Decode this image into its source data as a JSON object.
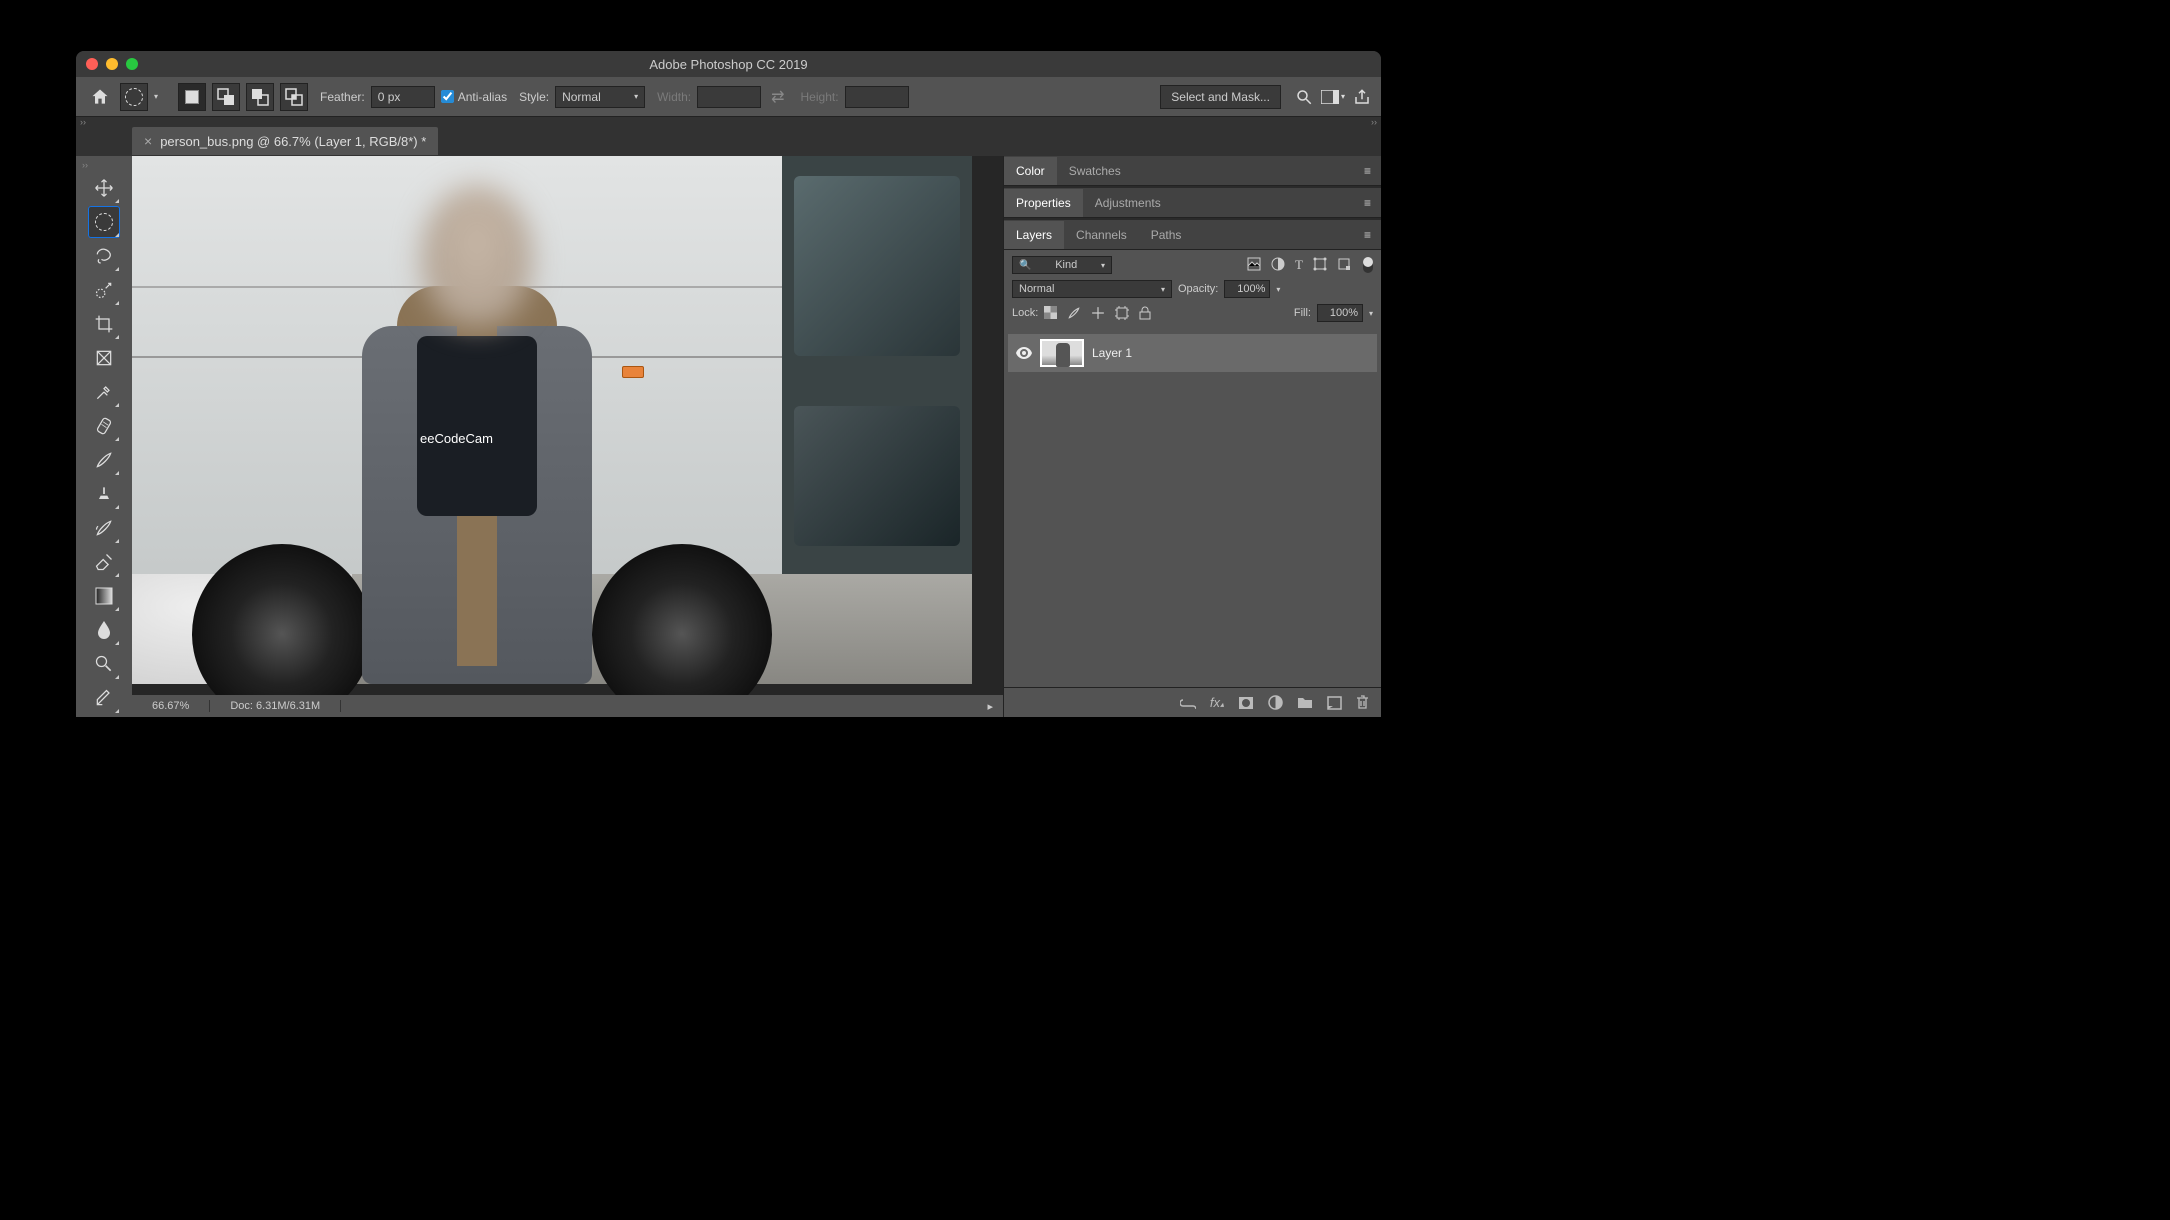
{
  "titlebar": {
    "title": "Adobe Photoshop CC 2019"
  },
  "options": {
    "feather_label": "Feather:",
    "feather_value": "0 px",
    "antialias_label": "Anti-alias",
    "antialias_checked": true,
    "style_label": "Style:",
    "style_value": "Normal",
    "width_label": "Width:",
    "width_value": "",
    "height_label": "Height:",
    "height_value": "",
    "select_mask": "Select and Mask..."
  },
  "tab": {
    "label": "person_bus.png @ 66.7% (Layer 1, RGB/8*) *"
  },
  "statusbar": {
    "zoom": "66.67%",
    "doc": "Doc: 6.31M/6.31M"
  },
  "panels": {
    "color_swatches": {
      "a": "Color",
      "b": "Swatches"
    },
    "props_adjust": {
      "a": "Properties",
      "b": "Adjustments"
    },
    "layers_tabs": {
      "a": "Layers",
      "b": "Channels",
      "c": "Paths"
    },
    "kind_label": "Kind",
    "blend_value": "Normal",
    "opacity_label": "Opacity:",
    "opacity_value": "100%",
    "lock_label": "Lock:",
    "fill_label": "Fill:",
    "fill_value": "100%",
    "layer1": "Layer 1"
  },
  "image": {
    "shirt_text": "eeCodeCam"
  }
}
